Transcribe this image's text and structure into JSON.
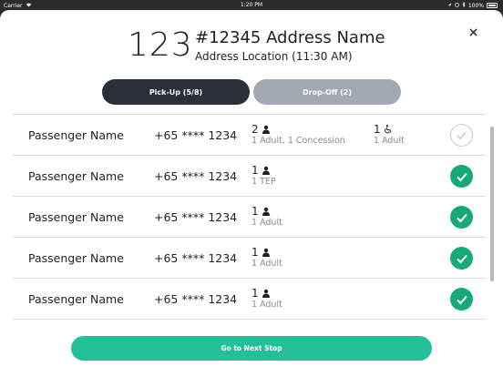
{
  "status_bar": {
    "carrier": "Carrier",
    "time": "1:20 PM",
    "battery": "100%"
  },
  "header": {
    "stop_number": "123",
    "address_name": "#12345 Address Name",
    "address_location": "Address Location (11:30 AM)"
  },
  "tabs": {
    "pickup_label": "Pick-Up (5/8)",
    "dropoff_label": "Drop-Off (2)",
    "active": "pickup"
  },
  "passengers": [
    {
      "name": "Passenger Name",
      "phone": "+65 **** 1234",
      "count": "2",
      "detail": "1 Adult, 1 Concession",
      "wheelchair_count": "1",
      "wheelchair_detail": "1 Adult",
      "checked": false
    },
    {
      "name": "Passenger Name",
      "phone": "+65 **** 1234",
      "count": "1",
      "detail": "1 TEP",
      "checked": true
    },
    {
      "name": "Passenger Name",
      "phone": "+65 **** 1234",
      "count": "1",
      "detail": "1 Adult",
      "checked": true
    },
    {
      "name": "Passenger Name",
      "phone": "+65 **** 1234",
      "count": "1",
      "detail": "1 Adult",
      "checked": true
    },
    {
      "name": "Passenger Name",
      "phone": "+65 **** 1234",
      "count": "1",
      "detail": "1 Adult",
      "checked": true
    }
  ],
  "footer": {
    "next_label": "Go to Next Stop"
  },
  "colors": {
    "accent_green": "#17a87c",
    "button_green": "#23bf98",
    "tab_active": "#2a2f3a",
    "tab_inactive": "#a3a9b3"
  },
  "icons": {
    "person": "person-icon",
    "wheelchair": "wheelchair-icon",
    "check": "checkmark-icon",
    "close": "close-icon"
  }
}
